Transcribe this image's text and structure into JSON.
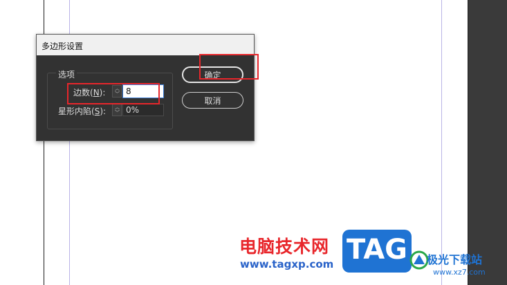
{
  "dialog": {
    "title": "多边形设置",
    "group_label": "选项",
    "sides": {
      "label_prefix": "边数(",
      "mnemonic": "N",
      "label_suffix": "):",
      "value": "8"
    },
    "star_inset": {
      "label_prefix": "星形内陷(",
      "mnemonic": "S",
      "label_suffix": "):",
      "value": "0%"
    },
    "buttons": {
      "ok": "确定",
      "cancel": "取消"
    }
  },
  "spinner": {
    "up_icon": "chevron-up-icon",
    "down_icon": "chevron-down-icon"
  },
  "watermark": {
    "brand": "电脑技术网",
    "url": "www.tagxp.com",
    "logo_text": "TAG",
    "site_name": "极光下载站",
    "site_url": "www.xz7.com"
  },
  "colors": {
    "highlight": "#e8262b",
    "dialog_bg": "#323232",
    "guide": "#b9b3e6",
    "logo_blue": "#1f73d3"
  }
}
